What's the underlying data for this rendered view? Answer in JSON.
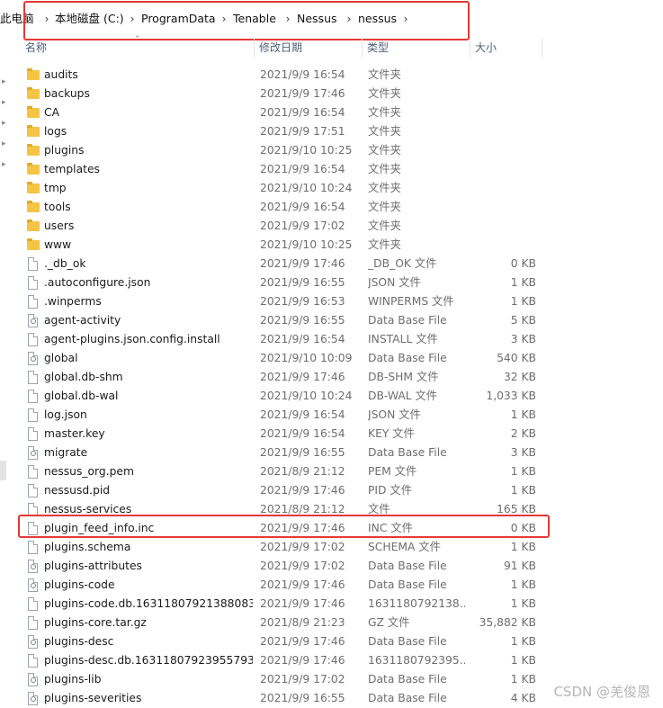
{
  "breadcrumb": [
    "此电脑",
    "本地磁盘 (C:)",
    "ProgramData",
    "Tenable",
    "Nessus",
    "nessus"
  ],
  "columns": {
    "name": "名称",
    "modified": "修改日期",
    "type": "类型",
    "size": "大小"
  },
  "files": [
    {
      "name": "audits",
      "modified": "2021/9/9 16:54",
      "type": "文件夹",
      "size": "",
      "icon": "folder-icon"
    },
    {
      "name": "backups",
      "modified": "2021/9/9 17:46",
      "type": "文件夹",
      "size": "",
      "icon": "folder-icon"
    },
    {
      "name": "CA",
      "modified": "2021/9/9 16:54",
      "type": "文件夹",
      "size": "",
      "icon": "folder-icon"
    },
    {
      "name": "logs",
      "modified": "2021/9/9 17:51",
      "type": "文件夹",
      "size": "",
      "icon": "folder-icon"
    },
    {
      "name": "plugins",
      "modified": "2021/9/10 10:25",
      "type": "文件夹",
      "size": "",
      "icon": "folder-icon"
    },
    {
      "name": "templates",
      "modified": "2021/9/9 16:54",
      "type": "文件夹",
      "size": "",
      "icon": "folder-icon"
    },
    {
      "name": "tmp",
      "modified": "2021/9/10 10:24",
      "type": "文件夹",
      "size": "",
      "icon": "folder-icon"
    },
    {
      "name": "tools",
      "modified": "2021/9/9 16:54",
      "type": "文件夹",
      "size": "",
      "icon": "folder-icon"
    },
    {
      "name": "users",
      "modified": "2021/9/9 17:02",
      "type": "文件夹",
      "size": "",
      "icon": "folder-icon"
    },
    {
      "name": "www",
      "modified": "2021/9/10 10:25",
      "type": "文件夹",
      "size": "",
      "icon": "folder-icon"
    },
    {
      "name": "._db_ok",
      "modified": "2021/9/9 17:46",
      "type": "_DB_OK 文件",
      "size": "0 KB",
      "icon": "file-icon"
    },
    {
      "name": ".autoconfigure.json",
      "modified": "2021/9/9 16:55",
      "type": "JSON 文件",
      "size": "1 KB",
      "icon": "file-icon"
    },
    {
      "name": ".winperms",
      "modified": "2021/9/9 16:53",
      "type": "WINPERMS 文件",
      "size": "1 KB",
      "icon": "file-icon"
    },
    {
      "name": "agent-activity",
      "modified": "2021/9/9 16:55",
      "type": "Data Base File",
      "size": "5 KB",
      "icon": "database-file-icon"
    },
    {
      "name": "agent-plugins.json.config.install",
      "modified": "2021/9/9 16:54",
      "type": "INSTALL 文件",
      "size": "3 KB",
      "icon": "file-icon"
    },
    {
      "name": "global",
      "modified": "2021/9/10 10:09",
      "type": "Data Base File",
      "size": "540 KB",
      "icon": "database-file-icon"
    },
    {
      "name": "global.db-shm",
      "modified": "2021/9/9 17:46",
      "type": "DB-SHM 文件",
      "size": "32 KB",
      "icon": "file-icon"
    },
    {
      "name": "global.db-wal",
      "modified": "2021/9/10 10:24",
      "type": "DB-WAL 文件",
      "size": "1,033 KB",
      "icon": "file-icon"
    },
    {
      "name": "log.json",
      "modified": "2021/9/9 16:54",
      "type": "JSON 文件",
      "size": "1 KB",
      "icon": "file-icon"
    },
    {
      "name": "master.key",
      "modified": "2021/9/9 16:54",
      "type": "KEY 文件",
      "size": "2 KB",
      "icon": "file-icon"
    },
    {
      "name": "migrate",
      "modified": "2021/9/9 16:55",
      "type": "Data Base File",
      "size": "3 KB",
      "icon": "database-file-icon"
    },
    {
      "name": "nessus_org.pem",
      "modified": "2021/8/9 21:12",
      "type": "PEM 文件",
      "size": "1 KB",
      "icon": "file-icon"
    },
    {
      "name": "nessusd.pid",
      "modified": "2021/9/9 17:46",
      "type": "PID 文件",
      "size": "1 KB",
      "icon": "file-icon"
    },
    {
      "name": "nessus-services",
      "modified": "2021/8/9 21:12",
      "type": "文件",
      "size": "165 KB",
      "icon": "file-icon"
    },
    {
      "name": "plugin_feed_info.inc",
      "modified": "2021/9/9 17:46",
      "type": "INC 文件",
      "size": "0 KB",
      "icon": "file-icon"
    },
    {
      "name": "plugins.schema",
      "modified": "2021/9/9 17:02",
      "type": "SCHEMA 文件",
      "size": "1 KB",
      "icon": "file-icon"
    },
    {
      "name": "plugins-attributes",
      "modified": "2021/9/9 17:02",
      "type": "Data Base File",
      "size": "91 KB",
      "icon": "database-file-icon"
    },
    {
      "name": "plugins-code",
      "modified": "2021/9/9 17:46",
      "type": "Data Base File",
      "size": "1 KB",
      "icon": "database-file-icon"
    },
    {
      "name": "plugins-code.db.16311807921388083...",
      "modified": "2021/9/9 17:46",
      "type": "1631180792138...",
      "size": "1 KB",
      "icon": "file-icon"
    },
    {
      "name": "plugins-core.tar.gz",
      "modified": "2021/8/9 21:23",
      "type": "GZ 文件",
      "size": "35,882 KB",
      "icon": "file-icon"
    },
    {
      "name": "plugins-desc",
      "modified": "2021/9/9 17:46",
      "type": "Data Base File",
      "size": "1 KB",
      "icon": "database-file-icon"
    },
    {
      "name": "plugins-desc.db.16311807923955793...",
      "modified": "2021/9/9 17:46",
      "type": "1631180792395...",
      "size": "1 KB",
      "icon": "file-icon"
    },
    {
      "name": "plugins-lib",
      "modified": "2021/9/9 17:02",
      "type": "Data Base File",
      "size": "1 KB",
      "icon": "database-file-icon"
    },
    {
      "name": "plugins-severities",
      "modified": "2021/9/9 16:55",
      "type": "Data Base File",
      "size": "4 KB",
      "icon": "database-file-icon"
    }
  ],
  "watermark": "CSDN @羌俊恩",
  "colors": {
    "highlight_box": "#e53935",
    "folder": "#f5c445",
    "header_text": "#4c607a",
    "secondary_text": "#6d6d6d"
  }
}
